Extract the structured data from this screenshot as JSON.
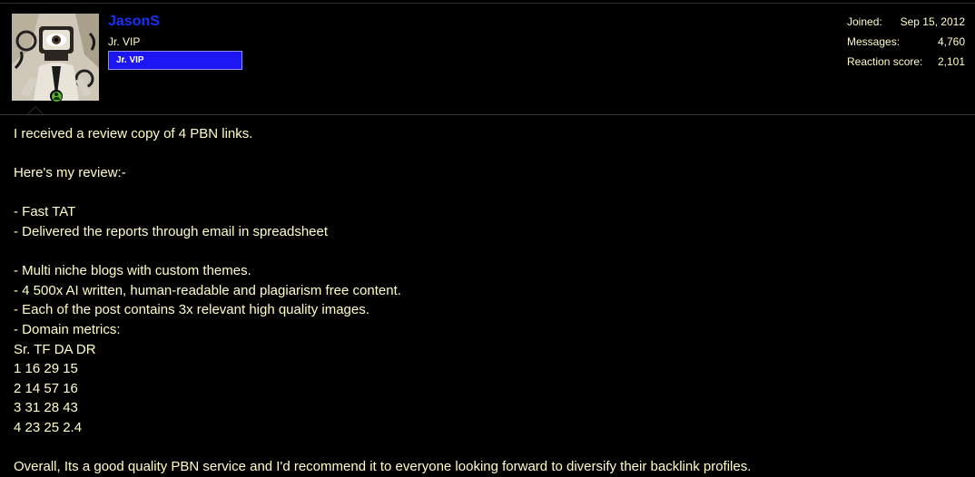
{
  "user": {
    "username": "JasonS",
    "title": "Jr. VIP",
    "banner": "Jr. VIP",
    "online": true
  },
  "stats": [
    {
      "label": "Joined:",
      "value": "Sep 15, 2012"
    },
    {
      "label": "Messages:",
      "value": "4,760"
    },
    {
      "label": "Reaction score:",
      "value": "2,101"
    }
  ],
  "post": {
    "line_1": "I received a review copy of 4 PBN links.",
    "line_2": "Here's my review:-",
    "line_3": "- Fast TAT",
    "line_4": "- Delivered the reports through email in spreadsheet",
    "line_5": "- Multi niche blogs with custom themes.",
    "line_6": "- 4 500x AI written, human-readable and plagiarism free content.",
    "line_7": "- Each of the post contains 3x relevant high quality images.",
    "line_8": "- Domain metrics:",
    "line_9": "Sr. TF DA DR",
    "line_10": "1 16 29 15",
    "line_11": "2 14 57 16",
    "line_12": "3 31 28 43",
    "line_13": "4 23 25 2.4",
    "line_14": "Overall, Its a good quality PBN service and I'd recommend it to everyone looking forward to diversify their backlink profiles."
  },
  "colors": {
    "background": "#000000",
    "text": "#fefec8",
    "username": "#1632f5",
    "banner_bg": "#1c16f2",
    "online": "#5bb02a"
  },
  "icons": {
    "avatar": "tv-head-avatar",
    "online_indicator": "online-user-icon"
  }
}
